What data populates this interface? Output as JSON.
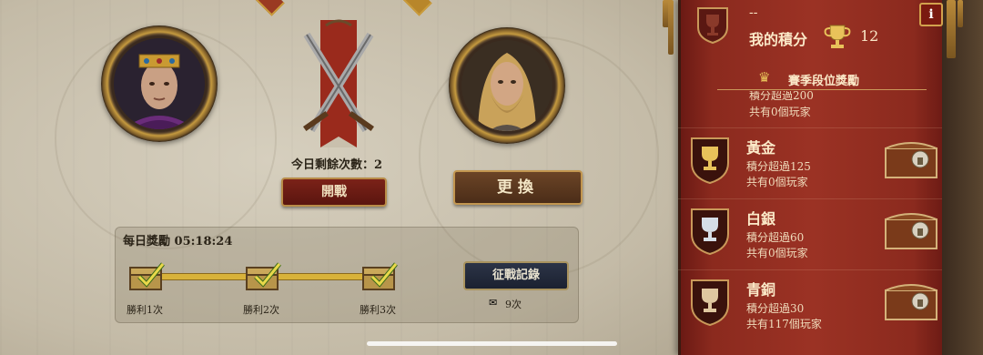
{
  "opponents": {
    "attempts_label": "今日剩餘次數：2",
    "battle_button": "開戰",
    "swap_button": "更換"
  },
  "daily": {
    "title": "每日獎勵 05:18:24",
    "milestones": [
      {
        "label": "勝利1次"
      },
      {
        "label": "勝利2次"
      },
      {
        "label": "勝利3次"
      }
    ],
    "record_button": "征戰記錄",
    "record_count": "9次"
  },
  "panel": {
    "player_name": "--",
    "score_label": "我的積分",
    "score_value": "12",
    "season_title": "賽季段位獎勵",
    "partial_row": {
      "condition": "積分超過200",
      "players": "共有0個玩家"
    },
    "ranks": [
      {
        "name": "黃金",
        "condition": "積分超過125",
        "players": "共有0個玩家",
        "color": "#e8c25a"
      },
      {
        "name": "白銀",
        "condition": "積分超過60",
        "players": "共有0個玩家",
        "color": "#d6dde6"
      },
      {
        "name": "青銅",
        "condition": "積分超過30",
        "players": "共有117個玩家",
        "color": "#e0c8a0"
      }
    ],
    "info_label": "i"
  },
  "icons": {
    "trophy": "trophy-icon",
    "crown": "crown-icon",
    "chest": "treasure-chest-icon",
    "swords": "crossed-swords-icon",
    "scroll": "scroll-icon"
  }
}
